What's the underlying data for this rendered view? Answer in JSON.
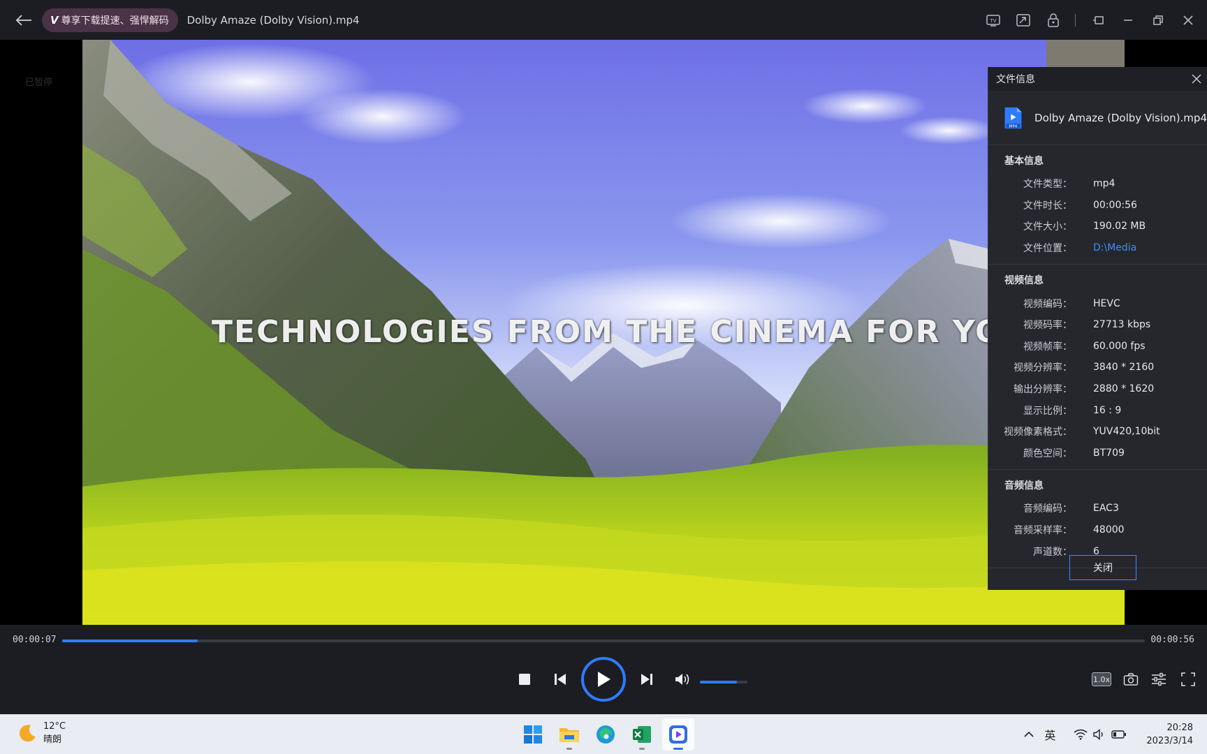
{
  "titlebar": {
    "vip_badge": "尊享下载提速、强悍解码",
    "file_title": "Dolby Amaze (Dolby Vision).mp4"
  },
  "video": {
    "paused_hint": "已暂停",
    "subtitle": "TECHNOLOGIES FROM THE CINEMA FOR YOUR TV"
  },
  "info_panel": {
    "title": "文件信息",
    "file_name": "Dolby Amaze (Dolby Vision).mp4",
    "file_badge": "MP4",
    "basic": {
      "title": "基本信息",
      "rows": [
        {
          "k": "文件类型：",
          "v": "mp4"
        },
        {
          "k": "文件时长：",
          "v": "00:00:56"
        },
        {
          "k": "文件大小：",
          "v": "190.02 MB"
        },
        {
          "k": "文件位置：",
          "v": "D:\\Media"
        }
      ]
    },
    "video": {
      "title": "视频信息",
      "rows": [
        {
          "k": "视频编码：",
          "v": "HEVC"
        },
        {
          "k": "视频码率：",
          "v": "27713 kbps"
        },
        {
          "k": "视频帧率：",
          "v": "60.000 fps"
        },
        {
          "k": "视频分辨率：",
          "v": "3840 * 2160"
        },
        {
          "k": "输出分辨率：",
          "v": "2880 * 1620"
        },
        {
          "k": "显示比例：",
          "v": "16 : 9"
        },
        {
          "k": "视频像素格式：",
          "v": "YUV420,10bit"
        },
        {
          "k": "颜色空间：",
          "v": "BT709"
        }
      ]
    },
    "audio": {
      "title": "音频信息",
      "rows": [
        {
          "k": "音频编码：",
          "v": "EAC3"
        },
        {
          "k": "音频采样率：",
          "v": "48000"
        },
        {
          "k": "声道数：",
          "v": "6"
        }
      ]
    },
    "close_button": "关闭"
  },
  "controls": {
    "current_time": "00:00:07",
    "total_time": "00:00:56",
    "progress": 0.125,
    "volume": 0.78,
    "speed": "1.0x",
    "accent": "#2f7bff"
  },
  "taskbar": {
    "temperature": "12°C",
    "weather": "晴朗",
    "ime": "英",
    "time": "20:28",
    "date": "2023/3/14"
  }
}
